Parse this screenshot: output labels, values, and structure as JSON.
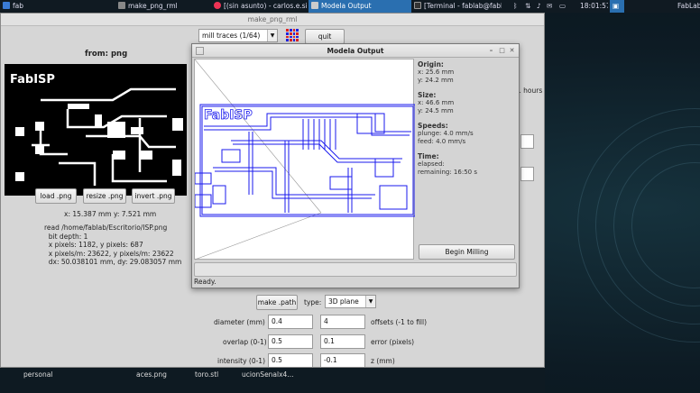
{
  "taskbar": {
    "launcher": "fab",
    "items": [
      {
        "label": "make_png_rml"
      },
      {
        "label": "[(sin asunto) - carlos.e.sil..."
      },
      {
        "label": "Modela Output"
      },
      {
        "label": "[Terminal - fablab@fabla..."
      }
    ],
    "clock": "18:01:57",
    "right": "FabLab"
  },
  "main": {
    "title": "make_png_rml",
    "mode": "mill traces (1/64)",
    "quit": "quit",
    "from": "from: png",
    "load": "load .png",
    "resize": "resize .png",
    "invert": "invert .png",
    "xy": "x: 15.387 mm   y: 7.521 mm",
    "read": [
      "read /home/fablab/Escritorio/ISP.png",
      "  bit depth: 1",
      "  x pixels: 1182, y pixels: 687",
      "  x pixels/m: 23622, y pixels/m: 23622",
      "  dx: 50.038101 mm, dy: 29.083057 mm"
    ],
    "hours": "1 hours",
    "make_path": "make .path",
    "type_label": "type:",
    "type_value": "3D plane",
    "diameter_label": "diameter (mm)",
    "diameter": "0.4",
    "offsets": "4",
    "offsets_label": "offsets (-1 to fill)",
    "overlap_label": "overlap (0-1)",
    "overlap": "0.5",
    "error": "0.1",
    "error_label": "error (pixels)",
    "intensity_label": "intensity (0-1)",
    "intensity": "0.5",
    "z": "-0.1",
    "z_label": "z (mm)"
  },
  "pcb_label": "FabISP",
  "modela": {
    "title": "Modela Output",
    "origin_h": "Origin:",
    "origin_x": "x: 25.6 mm",
    "origin_y": "y: 24.2 mm",
    "size_h": "Size:",
    "size_x": "x: 46.6 mm",
    "size_y": "y: 24.5 mm",
    "speeds_h": "Speeds:",
    "plunge": "plunge: 4.0 mm/s",
    "feed": "feed: 4.0 mm/s",
    "time_h": "Time:",
    "elapsed": "elapsed:",
    "remaining": "remaining: 16:50 s",
    "begin": "Begin Milling",
    "status": "Ready."
  },
  "desktop_icons": [
    "personal",
    "aces.png",
    "toro.stl",
    "ucionSenalx4..."
  ]
}
